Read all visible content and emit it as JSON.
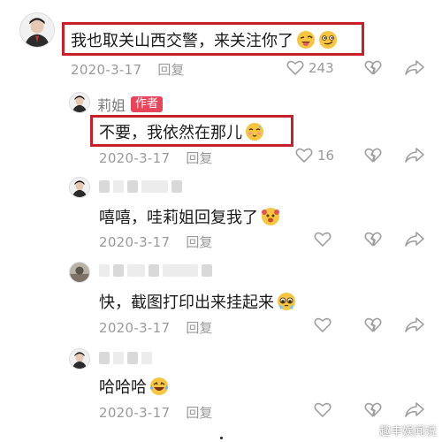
{
  "comments": [
    {
      "text": "我也取关山西交警，来关注你了",
      "date": "2020-3-17",
      "reply_label": "回复",
      "like_count": "243",
      "emojis": [
        "laugh-tongue-emoji",
        "smirk-emoji"
      ]
    },
    {
      "name": "莉姐",
      "badge": "作者",
      "text": "不要，我依然在那儿",
      "date": "2020-3-17",
      "reply_label": "回复",
      "like_count": "16",
      "emojis": [
        "blush-sweat-emoji"
      ]
    },
    {
      "text": "嘻嘻，哇莉姐回复我了",
      "date": "2020-3-17",
      "reply_label": "回复",
      "like_count": "",
      "emojis": [
        "excited-face-emoji"
      ]
    },
    {
      "text": "快，截图打印出来挂起来",
      "date": "2020-3-17",
      "reply_label": "回复",
      "like_count": "",
      "emojis": [
        "pleading-face-emoji"
      ]
    },
    {
      "text": "哈哈哈",
      "date": "2020-3-17",
      "reply_label": "回复",
      "like_count": "",
      "emojis": [
        "laughing-tears-emoji"
      ]
    }
  ],
  "watermark": "趣丰娱闻说",
  "colors": {
    "highlight_box": "#c8202a",
    "author_badge": "#e8445a",
    "meta_text": "#9a9a9a"
  },
  "icons": [
    "heart-icon",
    "broken-heart-icon",
    "share-icon"
  ]
}
